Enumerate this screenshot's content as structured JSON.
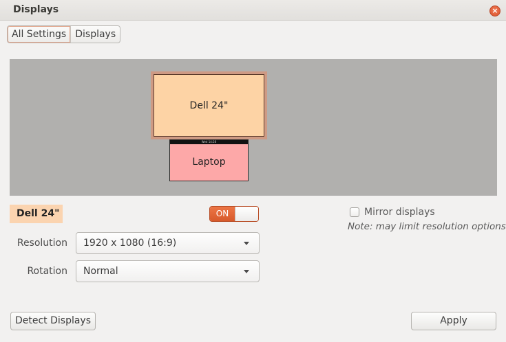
{
  "window": {
    "title": "Displays",
    "close_glyph": "×"
  },
  "breadcrumb": {
    "items": [
      "All Settings",
      "Displays"
    ]
  },
  "arrangement": {
    "monitors": [
      {
        "label": "Dell 24\"",
        "color": "#fdd3a5",
        "selected": true
      },
      {
        "label": "Laptop",
        "color": "#fda8a8",
        "panel_text": "Wed 14:26",
        "selected": false
      }
    ],
    "background_color": "#b1b0ae"
  },
  "selected_display": {
    "name": "Dell 24\"",
    "toggle_label": "ON",
    "toggle_state": true
  },
  "mirror": {
    "label": "Mirror displays",
    "checked": false,
    "note": "Note: may limit resolution options"
  },
  "settings": {
    "resolution_label": "Resolution",
    "resolution_value": "1920 x 1080 (16:9)",
    "rotation_label": "Rotation",
    "rotation_value": "Normal"
  },
  "buttons": {
    "detect": "Detect Displays",
    "apply": "Apply"
  },
  "colors": {
    "accent": "#dd5a2b",
    "window_bg": "#f2f1f0"
  }
}
